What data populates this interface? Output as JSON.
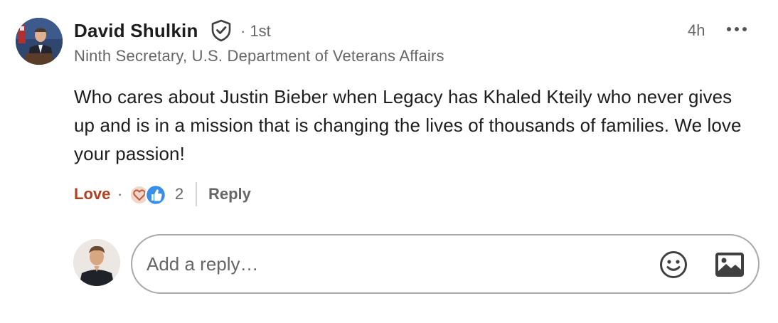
{
  "comment": {
    "author_name": "David Shulkin",
    "connection_degree": "· 1st",
    "timestamp": "4h",
    "headline": "Ninth Secretary, U.S. Department of Veterans Affairs",
    "text": "Who cares about Justin Bieber when Legacy has Khaled Kteily who never gives up and is in a mission that is changing the lives of thousands of families. We love your passion!"
  },
  "actions": {
    "love_label": "Love",
    "separator": "·",
    "reaction_count": "2",
    "reply_label": "Reply"
  },
  "composer": {
    "placeholder": "Add a reply…"
  },
  "icons": {
    "verified": "shield-check-icon",
    "more": "more-options-icon",
    "reaction_love": "heart-icon",
    "reaction_like": "thumbs-up-icon",
    "emoji": "emoji-icon",
    "image": "image-icon"
  },
  "colors": {
    "love_action": "#b24020",
    "like_blue": "#378fe9",
    "love_orange": "#df704d",
    "text_primary": "#1d1d1d",
    "text_secondary": "#666666",
    "input_border": "#a9a9a9"
  }
}
